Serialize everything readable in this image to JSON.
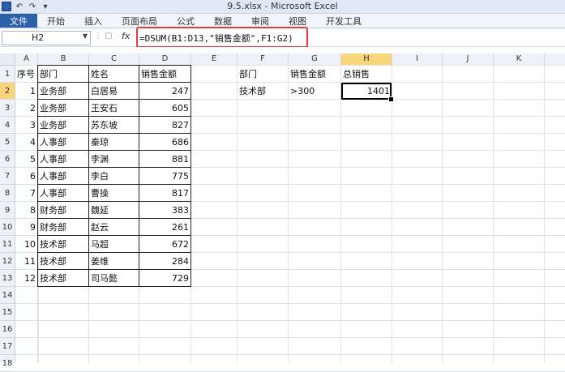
{
  "window": {
    "title": "9.5.xlsx - Microsoft Excel",
    "qat": [
      {
        "icon": "save-icon"
      },
      {
        "icon": "undo-icon"
      },
      {
        "icon": "redo-icon"
      },
      {
        "icon": "customize-qat-icon"
      }
    ]
  },
  "ribbon": {
    "file_tab": "文件",
    "tabs": [
      "开始",
      "插入",
      "页面布局",
      "公式",
      "数据",
      "审阅",
      "视图",
      "开发工具"
    ]
  },
  "formula_bar": {
    "name_box": "H2",
    "fx_label": "fx",
    "formula": "=DSUM(B1:D13,\"销售金额\",F1:G2)"
  },
  "columns": [
    "A",
    "B",
    "C",
    "D",
    "E",
    "F",
    "G",
    "H",
    "I",
    "J",
    "K"
  ],
  "rows": [
    "1",
    "2",
    "3",
    "4",
    "5",
    "6",
    "7",
    "8",
    "9",
    "10",
    "11",
    "12",
    "13",
    "14",
    "15",
    "16",
    "17",
    "18"
  ],
  "active_cell": {
    "col": "H",
    "row": "2"
  },
  "table": {
    "headers": [
      "序号",
      "部门",
      "姓名",
      "销售金额"
    ],
    "rows": [
      [
        "1",
        "业务部",
        "白居易",
        "247"
      ],
      [
        "2",
        "业务部",
        "王安石",
        "605"
      ],
      [
        "3",
        "业务部",
        "苏东坡",
        "827"
      ],
      [
        "4",
        "人事部",
        "秦琼",
        "686"
      ],
      [
        "5",
        "人事部",
        "李渊",
        "881"
      ],
      [
        "6",
        "人事部",
        "李白",
        "775"
      ],
      [
        "7",
        "人事部",
        "曹操",
        "817"
      ],
      [
        "8",
        "财务部",
        "魏延",
        "383"
      ],
      [
        "9",
        "财务部",
        "赵云",
        "261"
      ],
      [
        "10",
        "技术部",
        "马超",
        "672"
      ],
      [
        "11",
        "技术部",
        "姜维",
        "284"
      ],
      [
        "12",
        "技术部",
        "司马懿",
        "729"
      ]
    ]
  },
  "criteria": {
    "headers": [
      "部门",
      "销售金额",
      "总销售"
    ],
    "values": [
      "技术部",
      ">300",
      "1401"
    ]
  }
}
